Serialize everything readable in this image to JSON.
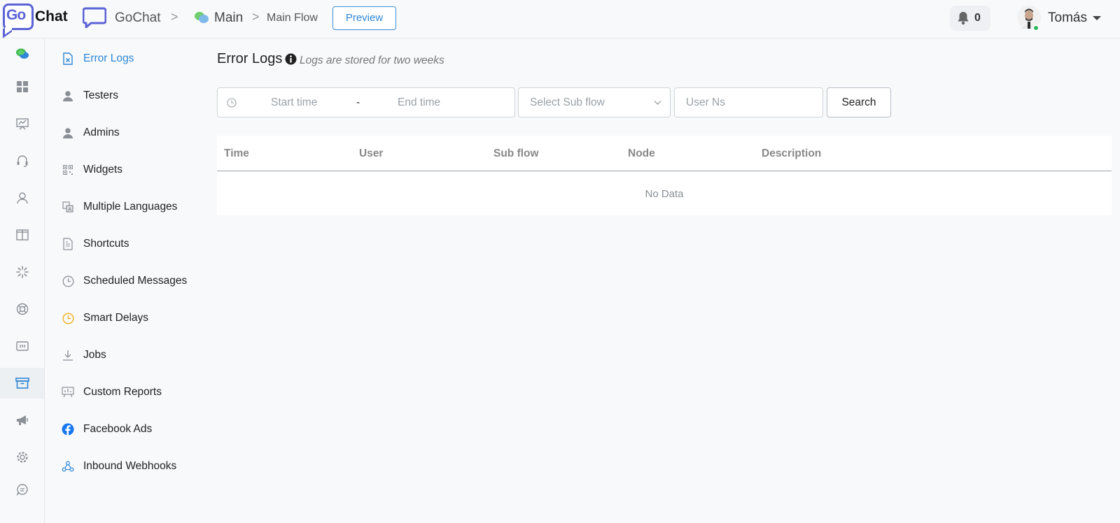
{
  "brand": {
    "logo_go": "Go",
    "logo_chat": "Chat",
    "app_name": "GoChat"
  },
  "breadcrumb": {
    "main": "Main",
    "flow": "Main Flow",
    "separator": ">"
  },
  "header": {
    "preview_label": "Preview",
    "notification_count": "0",
    "user_name": "Tomás"
  },
  "rail": {
    "items": [
      {
        "icon": "chat-bubbles-icon"
      },
      {
        "icon": "dashboard-icon"
      },
      {
        "icon": "chart-board-icon"
      },
      {
        "icon": "headset-icon"
      },
      {
        "icon": "user-icon"
      },
      {
        "icon": "columns-icon"
      },
      {
        "icon": "loading-icon"
      },
      {
        "icon": "lifebuoy-icon"
      },
      {
        "icon": "keyboard-icon"
      },
      {
        "icon": "archive-icon"
      },
      {
        "icon": "megaphone-icon"
      },
      {
        "icon": "settings-icon"
      },
      {
        "icon": "comment-icon"
      }
    ],
    "active_index": 9
  },
  "subnav": {
    "items": [
      {
        "label": "Error Logs",
        "icon": "error-log-icon",
        "active": true
      },
      {
        "label": "Testers",
        "icon": "person-icon"
      },
      {
        "label": "Admins",
        "icon": "person-icon"
      },
      {
        "label": "Widgets",
        "icon": "qr-icon"
      },
      {
        "label": "Multiple Languages",
        "icon": "translate-icon"
      },
      {
        "label": "Shortcuts",
        "icon": "document-icon"
      },
      {
        "label": "Scheduled Messages",
        "icon": "clock-icon"
      },
      {
        "label": "Smart Delays",
        "icon": "clock-icon"
      },
      {
        "label": "Jobs",
        "icon": "download-icon"
      },
      {
        "label": "Custom Reports",
        "icon": "report-icon"
      },
      {
        "label": "Facebook Ads",
        "icon": "facebook-icon"
      },
      {
        "label": "Inbound Webhooks",
        "icon": "webhook-icon"
      }
    ]
  },
  "main": {
    "title": "Error Logs",
    "subtitle": "Logs are stored for two weeks",
    "filters": {
      "start_placeholder": "Start time",
      "range_separator": "-",
      "end_placeholder": "End time",
      "subflow_placeholder": "Select Sub flow",
      "user_placeholder": "User Ns",
      "search_label": "Search"
    },
    "table": {
      "columns": [
        "Time",
        "User",
        "Sub flow",
        "Node",
        "Description"
      ],
      "empty_text": "No Data"
    }
  },
  "colors": {
    "accent": "#2d86d6",
    "brand": "#5b63d6",
    "online": "#2eb85c",
    "smart_delay": "#f0b429"
  }
}
